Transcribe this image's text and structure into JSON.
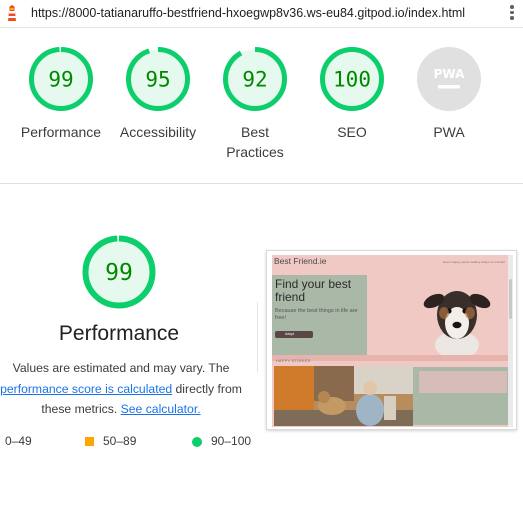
{
  "browser": {
    "url": "https://8000-tatianaruffo-bestfriend-hxoegwp8v36.ws-eu84.gitpod.io/index.html"
  },
  "gauges": [
    {
      "label": "Performance",
      "score": "99",
      "fraction": 0.99
    },
    {
      "label": "Accessibility",
      "score": "95",
      "fraction": 0.95
    },
    {
      "label": "Best Practices",
      "score": "92",
      "fraction": 0.92
    },
    {
      "label": "SEO",
      "score": "100",
      "fraction": 1.0
    },
    {
      "label": "PWA",
      "badge": "PWA"
    }
  ],
  "performance": {
    "score": "99",
    "fraction": 0.99,
    "title": "Performance",
    "desc_prefix": "Values are estimated and may vary. The ",
    "desc_link": "performance score is calculated",
    "desc_middle": " directly from these metrics. ",
    "calc_link": "See calculator."
  },
  "legend": {
    "fail": "0–49",
    "average": "50–89",
    "pass": "90–100"
  },
  "screenshot": {
    "brand": "Best Friend.ie",
    "nav": "Home   Happy stories   Gallery   Adopt me   Contact",
    "hero_title": "Find your best friend",
    "hero_sub": "Because the best things in life are free!",
    "button": "Adopt",
    "stories_label": "HAPPY STORIES"
  },
  "colors": {
    "pass": "#0cce6b",
    "pass_text": "#008800",
    "pass_fill": "#e6f9ee",
    "average": "#ffa400",
    "fail": "#ff4e42",
    "pwa_grey": "#e0e0e0"
  }
}
